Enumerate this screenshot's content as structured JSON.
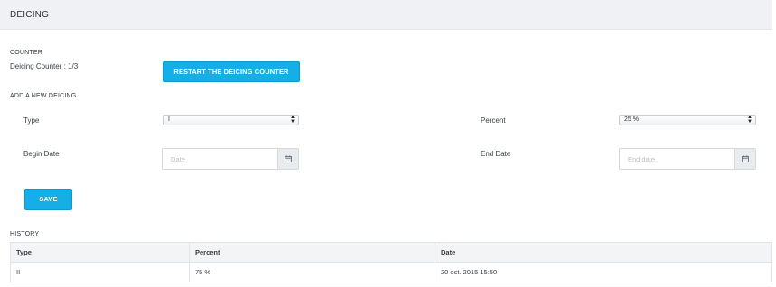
{
  "header": {
    "title": "DEICING"
  },
  "counter": {
    "section_label": "COUNTER",
    "text": "Deicing Counter : 1/3",
    "restart_button": "RESTART THE DEICING COUNTER"
  },
  "add_new": {
    "section_label": "ADD A NEW DEICING",
    "type_label": "Type",
    "type_value": "I",
    "percent_label": "Percent",
    "percent_value": "25 %",
    "begin_date_label": "Begin Date",
    "begin_date_placeholder": "Date",
    "end_date_label": "End Date",
    "end_date_placeholder": "End date",
    "save_button": "SAVE"
  },
  "history": {
    "section_label": "HISTORY",
    "columns": [
      "Type",
      "Percent",
      "Date"
    ],
    "rows": [
      [
        "II",
        "75 %",
        "20 oct. 2015 15:50"
      ]
    ]
  },
  "colors": {
    "accent": "#15aee6",
    "header_bg": "#eff1f4"
  },
  "icons": {
    "calendar": "calendar-icon",
    "select_arrows": "updown-arrows-icon"
  }
}
